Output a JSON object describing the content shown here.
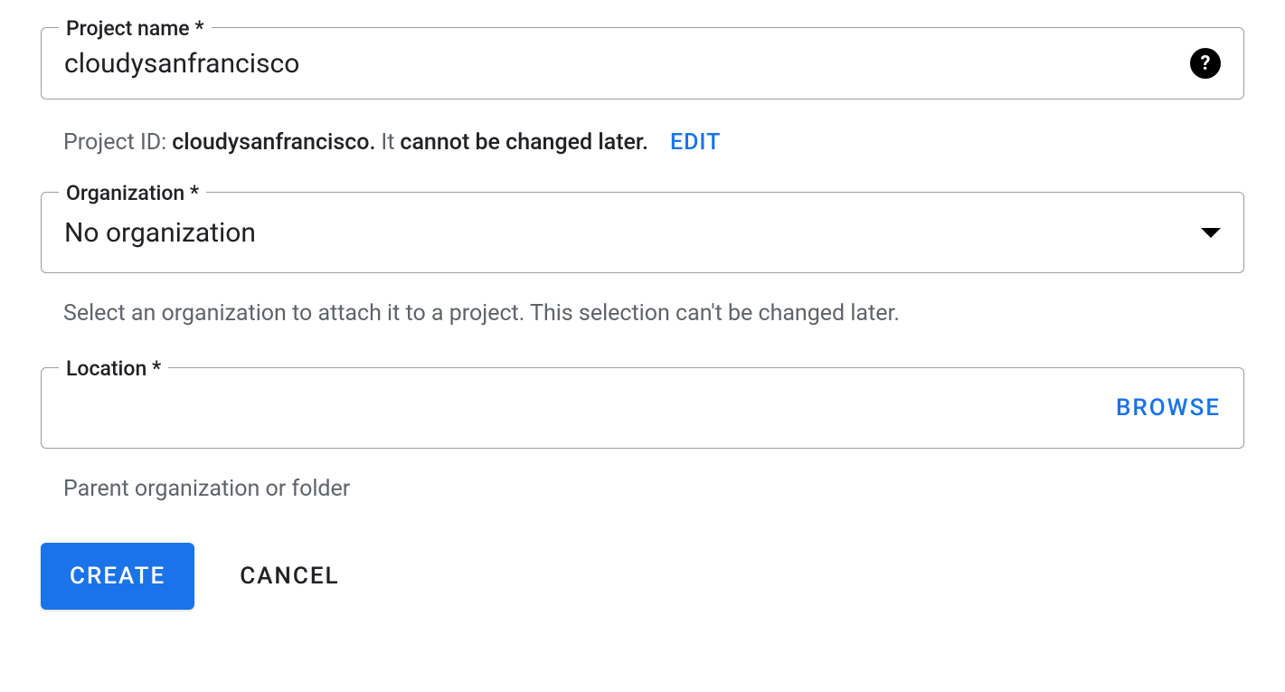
{
  "projectName": {
    "label": "Project name *",
    "value": "cloudysanfrancisco",
    "hintPrefix": "Project ID:",
    "projectId": "cloudysanfrancisco.",
    "hintMid": "It",
    "hintStrong": "cannot be changed later.",
    "editLabel": "EDIT"
  },
  "organization": {
    "label": "Organization *",
    "value": "No organization",
    "hint": "Select an organization to attach it to a project. This selection can't be changed later."
  },
  "location": {
    "label": "Location *",
    "browseLabel": "BROWSE",
    "hint": "Parent organization or folder"
  },
  "buttons": {
    "create": "CREATE",
    "cancel": "CANCEL"
  }
}
